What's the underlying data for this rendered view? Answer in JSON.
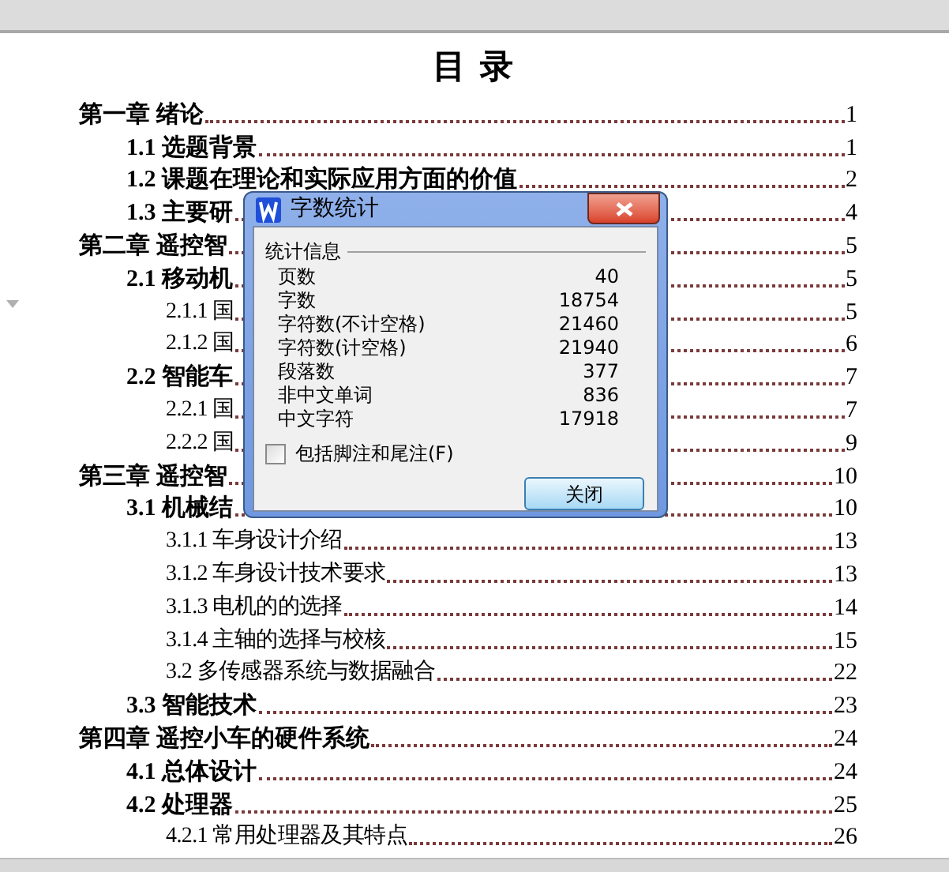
{
  "document": {
    "title": "目 录",
    "toc": [
      {
        "kind": "chapter",
        "text": "第一章  绪论",
        "page": "1"
      },
      {
        "kind": "section",
        "text": "1.1 选题背景",
        "page": "1"
      },
      {
        "kind": "section",
        "text": "1.2 课题在理论和实际应用方面的价值",
        "page": "2"
      },
      {
        "kind": "section",
        "text": "1.3 主要研",
        "page": "4"
      },
      {
        "kind": "chapter",
        "text": "第二章  遥控智",
        "page": "5"
      },
      {
        "kind": "section",
        "text": "2.1 移动机",
        "page": "5"
      },
      {
        "kind": "subsection",
        "text": "2.1.1 国",
        "page": "5"
      },
      {
        "kind": "subsection",
        "text": "2.1.2 国",
        "page": "6"
      },
      {
        "kind": "section",
        "text": "2.2 智能车",
        "page": "7"
      },
      {
        "kind": "subsection",
        "text": "2.2.1 国",
        "page": "7"
      },
      {
        "kind": "subsection",
        "text": "2.2.2 国",
        "page": "9"
      },
      {
        "kind": "chapter",
        "text": "第三章  遥控智",
        "page": "10"
      },
      {
        "kind": "section",
        "text": "3.1 机械结",
        "page": "10"
      },
      {
        "kind": "subsection",
        "text": "3.1.1 车身设计介绍",
        "page": "13"
      },
      {
        "kind": "subsection",
        "text": "3.1.2 车身设计技术要求",
        "page": "13"
      },
      {
        "kind": "subsection",
        "text": "3.1.3  电机的的选择",
        "page": "14"
      },
      {
        "kind": "subsection",
        "text": "3.1.4  主轴的选择与校核",
        "page": "15"
      },
      {
        "kind": "subsection",
        "text": "3.2 多传感器系统与数据融合",
        "page": "22"
      },
      {
        "kind": "section",
        "text": "3.3 智能技术",
        "page": "23"
      },
      {
        "kind": "chapter",
        "text": "第四章  遥控小车的硬件系统",
        "page": "24"
      },
      {
        "kind": "section",
        "text": "4.1 总体设计",
        "page": "24"
      },
      {
        "kind": "section",
        "text": "4.2 处理器",
        "page": "25"
      },
      {
        "kind": "subsection",
        "text": "4.2.1 常用处理器及其特点",
        "page": "26"
      }
    ]
  },
  "dialog": {
    "title": "字数统计",
    "group": "统计信息",
    "stats": [
      {
        "label": "页数",
        "value": "40"
      },
      {
        "label": "字数",
        "value": "18754"
      },
      {
        "label": "字符数(不计空格)",
        "value": "21460"
      },
      {
        "label": "字符数(计空格)",
        "value": "21940"
      },
      {
        "label": "段落数",
        "value": "377"
      },
      {
        "label": "非中文单词",
        "value": "836"
      },
      {
        "label": "中文字符",
        "value": "17918"
      }
    ],
    "checkbox": {
      "label": "包括脚注和尾注(F)",
      "checked": false
    },
    "close_button": "关闭"
  }
}
